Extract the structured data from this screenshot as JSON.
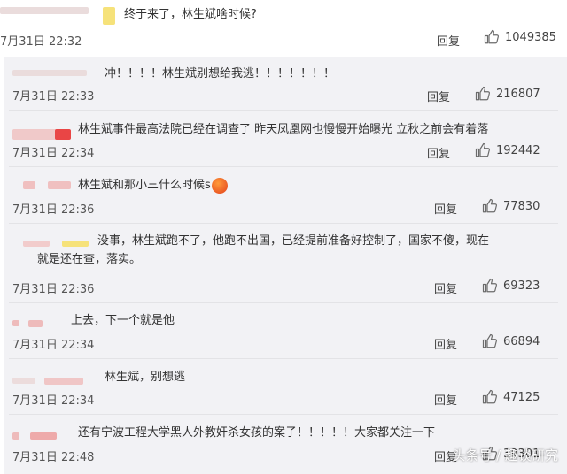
{
  "top_comment": {
    "text": "终于来了，林生斌啥时候?",
    "time": "7月31日 22:32",
    "reply_label": "回复",
    "likes": "1049385"
  },
  "replies": [
    {
      "text": "冲！！！！林生斌别想给我逃！！！！！！！",
      "time": "7月31日 22:33",
      "reply_label": "回复",
      "likes": "216807"
    },
    {
      "text": "林生斌事件最高法院已经在调查了  昨天凤凰网也慢慢开始曝光  立秋之前会有着落",
      "time": "7月31日 22:34",
      "reply_label": "回复",
      "likes": "192442"
    },
    {
      "text": "林生斌和那小三什么时候s",
      "time": "7月31日 22:36",
      "reply_label": "回复",
      "likes": "77830",
      "emoji": "angry-face-icon"
    },
    {
      "text": "没事，林生斌跑不了，他跑不出国，已经提前准备好控制了，国家不傻，现在就是还在查，落实。",
      "time": "7月31日 22:36",
      "reply_label": "回复",
      "likes": "69323"
    },
    {
      "text": "上去，下一个就是他",
      "time": "7月31日 22:34",
      "reply_label": "回复",
      "likes": "66894"
    },
    {
      "text": "林生斌，别想逃",
      "time": "7月31日 22:34",
      "reply_label": "回复",
      "likes": "47125"
    },
    {
      "text": "还有宁波工程大学黑人外教奸杀女孩的案子！！！！！大家都关注一下",
      "time": "7月31日 22:48",
      "reply_label": "回复",
      "likes": "39301"
    }
  ],
  "watermark": "头条号 / 趣谈研究",
  "colors": {
    "panel_bg": "#f2f2f5",
    "text": "#333333",
    "meta": "#555555",
    "icon": "#6b6b6b"
  },
  "icons": {
    "like": "thumbs-up-icon"
  }
}
